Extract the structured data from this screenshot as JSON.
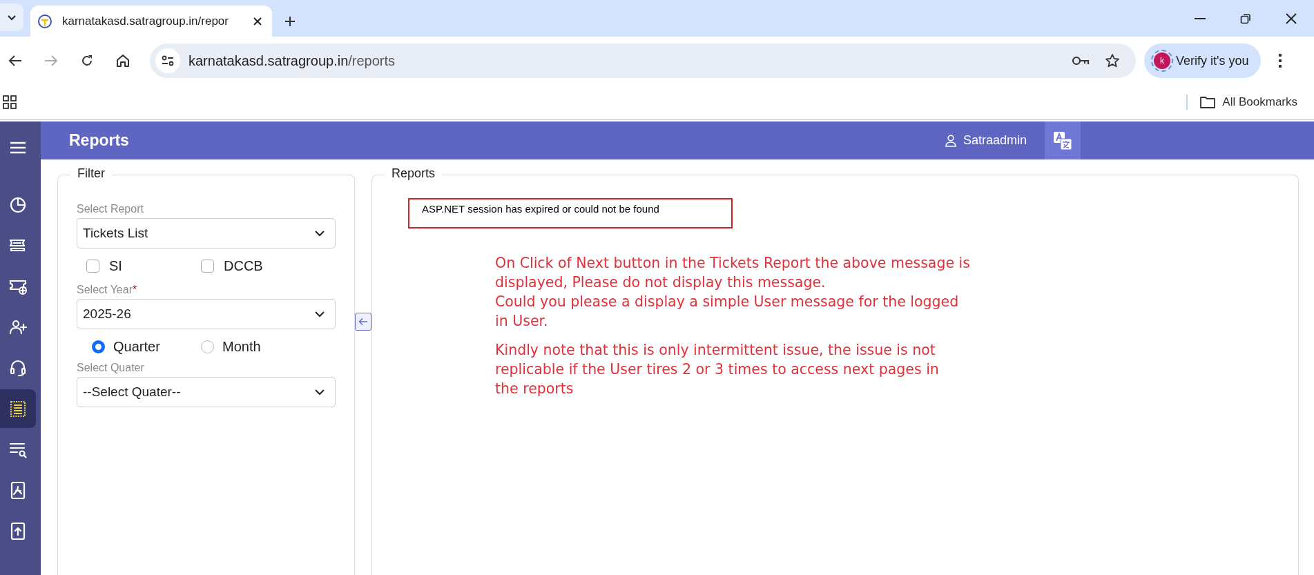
{
  "browser": {
    "tab": {
      "title": "karnatakasd.satragroup.in/repor",
      "selected": true
    },
    "address": {
      "host": "karnatakasd.satragroup.in",
      "path": "/reports"
    },
    "profile_button": {
      "avatar": "k",
      "label": "Verify it's you"
    },
    "bookmarks": {
      "label": "All Bookmarks"
    }
  },
  "app": {
    "title": "Reports",
    "user": "Satraadmin"
  },
  "sidebar": {
    "items": [
      {
        "kind": "dashboard",
        "selected": false
      },
      {
        "kind": "tickets",
        "selected": false
      },
      {
        "kind": "ticket-add",
        "selected": false
      },
      {
        "kind": "user-add",
        "selected": false
      },
      {
        "kind": "support",
        "selected": false
      },
      {
        "kind": "report",
        "selected": true
      },
      {
        "kind": "list-search",
        "selected": false
      },
      {
        "kind": "pdf",
        "selected": false
      },
      {
        "kind": "upload",
        "selected": false
      }
    ]
  },
  "filter": {
    "legend": "Filter",
    "report": {
      "label": "Select Report",
      "value": "Tickets List"
    },
    "checkboxes": [
      {
        "label": "SI",
        "checked": false
      },
      {
        "label": "DCCB",
        "checked": false
      }
    ],
    "year": {
      "label": "Select Year",
      "required_mark": "*",
      "value": "2025-26"
    },
    "period": [
      {
        "label": "Quarter",
        "selected": true
      },
      {
        "label": "Month",
        "selected": false
      }
    ],
    "quarter": {
      "label": "Select Quater",
      "value": "--Select Quater--"
    }
  },
  "reports": {
    "legend": "Reports",
    "error": "ASP.NET session has expired or could not be found",
    "notes": [
      [
        "On Click of Next button in the Tickets Report the above message is",
        "displayed, Please do not display this message.",
        "Could you please a display a simple User message  for the logged",
        "in User."
      ],
      [
        "Kindly note that this is only intermittent issue, the issue is not",
        "replicable if the User tires 2 or 3 times to access next pages in",
        "the reports"
      ]
    ]
  }
}
